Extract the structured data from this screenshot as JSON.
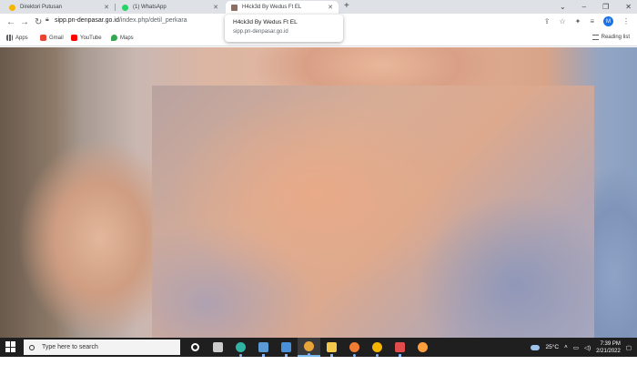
{
  "browser": {
    "tabs": [
      {
        "label": "Direktori Putusan",
        "favicon_color": "#f4b400"
      },
      {
        "label": "(1) WhatsApp",
        "favicon_color": "#25d366"
      },
      {
        "label": "H4ck3d By Wedus Ft EL",
        "favicon_color": "#8d6e63"
      }
    ],
    "new_tab_label": "+",
    "address": {
      "host": "sipp.pn-denpasar.go.id",
      "path": "/index.php/detil_perkara"
    },
    "tooltip": {
      "title": "H4ck3d By Wedus Ft EL",
      "url": "sipp.pn-denpasar.go.id"
    },
    "profile_initial": "M",
    "bookmarks": [
      {
        "label": "Apps",
        "icon": "apps-grid-icon",
        "color": "#5f6368"
      },
      {
        "label": "Gmail",
        "icon": "gmail-icon",
        "color": "#ea4335"
      },
      {
        "label": "YouTube",
        "icon": "youtube-icon",
        "color": "#ff0000"
      },
      {
        "label": "Maps",
        "icon": "maps-icon",
        "color": "#34a853"
      }
    ],
    "reading_list": "Reading list"
  },
  "taskbar": {
    "search_placeholder": "Type here to search",
    "pinned_apps": [
      {
        "name": "cortana-icon",
        "color": "#ffffff",
        "round": true
      },
      {
        "name": "task-view-icon",
        "color": "#cccccc",
        "round": false
      },
      {
        "name": "edge-icon",
        "color": "#2fb4a4",
        "round": true
      },
      {
        "name": "store-icon",
        "color": "#5a9bd5",
        "round": false
      },
      {
        "name": "mail-icon",
        "color": "#4a90d9",
        "round": false
      },
      {
        "name": "chrome-icon",
        "color": "#e8a53a",
        "round": true
      },
      {
        "name": "file-explorer-icon",
        "color": "#f2c94c",
        "round": false
      },
      {
        "name": "firefox-icon",
        "color": "#f07c33",
        "round": true
      },
      {
        "name": "chrome-canary-icon",
        "color": "#f4b400",
        "round": true
      },
      {
        "name": "vivaldi-icon",
        "color": "#e04b4b",
        "round": false
      },
      {
        "name": "settings-gear-icon",
        "color": "#ff9e3d",
        "round": true
      }
    ],
    "weather": "25°C",
    "time": "7:39 PM",
    "date": "2/21/2022"
  }
}
